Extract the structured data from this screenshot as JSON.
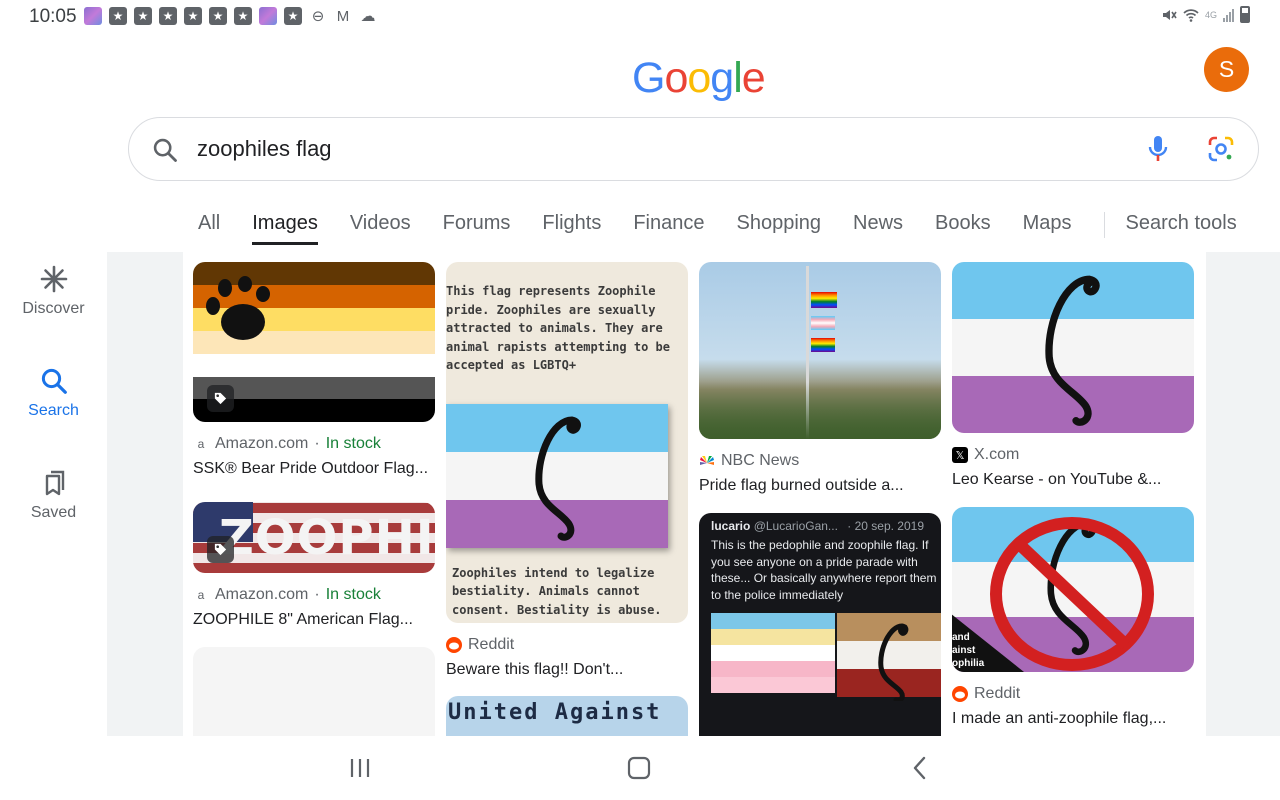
{
  "status_bar": {
    "time": "10:05",
    "network": "4G",
    "icons": [
      "photo-icon",
      "star-icon",
      "star-icon",
      "star-icon",
      "star-icon",
      "star-icon",
      "star-icon",
      "photo-icon",
      "star-icon",
      "dnd-icon",
      "gmail-icon",
      "cloud-icon"
    ]
  },
  "header": {
    "logo_letters": [
      "G",
      "o",
      "o",
      "g",
      "l",
      "e"
    ],
    "logo_colors": [
      "#4285F4",
      "#EA4335",
      "#FBBC05",
      "#4285F4",
      "#34A853",
      "#EA4335"
    ],
    "avatar_initial": "S",
    "avatar_color": "#ea6c0b"
  },
  "search": {
    "query": "zoophiles flag"
  },
  "tabs": {
    "items": [
      "All",
      "Images",
      "Videos",
      "Forums",
      "Flights",
      "Finance",
      "Shopping",
      "News",
      "Books",
      "Maps"
    ],
    "active": "Images",
    "tools": "Search tools"
  },
  "rail": {
    "discover": "Discover",
    "search": "Search",
    "saved": "Saved"
  },
  "results": {
    "c1": {
      "source": "Amazon.com",
      "stock": "In stock",
      "title": "SSK® Bear Pride Outdoor Flag..."
    },
    "c2": {
      "source": "Amazon.com",
      "stock": "In stock",
      "title": "ZOOPHILE 8\" American Flag...",
      "image_text": "ZOOPHILE"
    },
    "c3": {
      "source": "Reddit",
      "title": "Beware this flag!! Don't...",
      "image_text_top": "This flag represents Zoophile pride. Zoophiles are sexually attracted to animals. They are animal rapists attempting to be accepted as LGBTQ+",
      "image_text_bottom": "Zoophiles intend to legalize bestiality. Animals cannot consent. Bestiality is abuse."
    },
    "c4": {
      "image_text": "United Against"
    },
    "c5": {
      "source": "NBC News",
      "title": "Pride flag burned outside a..."
    },
    "c6": {
      "tweet_user": "lucario",
      "tweet_handle": "@LucarioGan...",
      "tweet_date": "· 20 sep. 2019",
      "tweet_text": "This is the pedophile and zoophile flag. If you see anyone on a pride parade with these... Or basically anywhere report them to the police immediately"
    },
    "c7": {
      "source": "X.com",
      "title": "Leo Kearse - on YouTube &..."
    },
    "c8": {
      "source": "Reddit",
      "title": "I made an anti-zoophile flag,...",
      "image_text": "and\nainst\nophilia"
    }
  },
  "colors": {
    "accent_blue": "#1a73e8",
    "stock_green": "#188038",
    "flag_blue": "#6fc6ee",
    "flag_white": "#f5f5f5",
    "flag_purple": "#a869b7"
  }
}
